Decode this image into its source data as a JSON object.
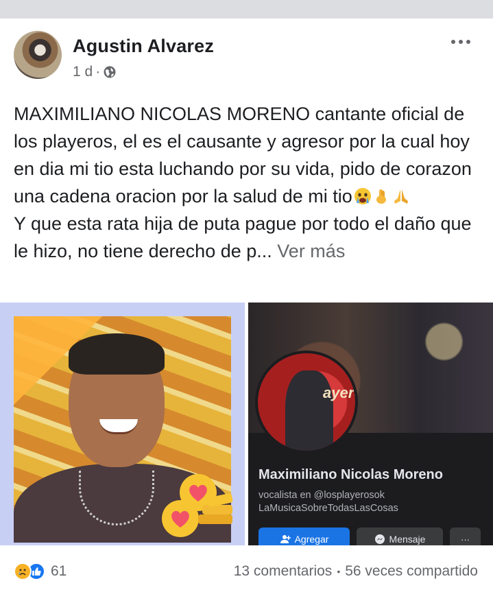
{
  "post": {
    "author": "Agustin Alvarez",
    "time": "1 d",
    "separator": "·",
    "paragraph1": "MAXIMILIANO NICOLAS MORENO cantante oficial de los playeros, el es el causante y agresor por la cual hoy en dia mi tio esta luchando por su vida, pido de corazon una cadena oracion por la salud de mi tio",
    "paragraph2": "Y que esta rata hija de puta pague por todo el daño que le hizo, no tiene derecho de p...",
    "see_more": "Ver más",
    "icons": {
      "privacy": "globe-icon",
      "menu": "more-options-icon",
      "emojis": [
        "crying-face-emoji",
        "crossed-fingers-emoji",
        "praying-hands-emoji"
      ]
    }
  },
  "page_card": {
    "cover_brand": "ayero",
    "name": "Maximiliano Nicolas Moreno",
    "description_line1": "vocalista en @losplayerosok",
    "description_line2": "LaMusicaSobreTodasLasCosas",
    "add_button": "Agregar",
    "message_button": "Mensaje",
    "more_button": "···"
  },
  "footer": {
    "reaction_count": "61",
    "comments": "13 comentarios",
    "dot": "•",
    "shares": "56 veces compartido"
  },
  "colors": {
    "primary_blue": "#1b74e4",
    "text": "#1c1e21",
    "secondary_text": "#65676b",
    "frame_lavender": "#c8cff5",
    "dark_card": "#1c1c1f"
  }
}
